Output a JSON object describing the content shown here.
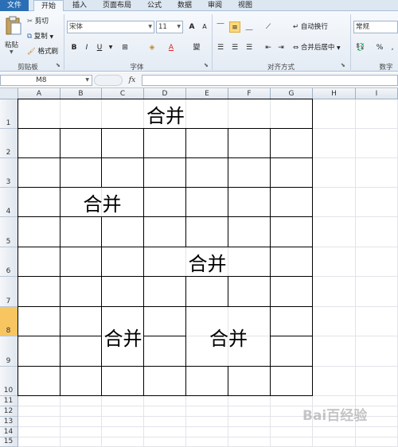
{
  "tabs": [
    "文件",
    "开始",
    "插入",
    "页面布局",
    "公式",
    "数据",
    "审阅",
    "视图"
  ],
  "active_tab": "开始",
  "ribbon": {
    "clipboard": {
      "paste": "粘贴",
      "cut": "剪切",
      "copy": "复制",
      "format_painter": "格式刷",
      "group": "剪贴板"
    },
    "font": {
      "name": "宋体",
      "size": "11",
      "bold": "B",
      "italic": "I",
      "underline": "U",
      "wen": "變",
      "font_color_glyph": "A",
      "grow": "A",
      "shrink": "A",
      "group": "字体"
    },
    "alignment": {
      "wrap": "自动换行",
      "merge": "合并后居中",
      "group": "对齐方式"
    },
    "number": {
      "format": "常规",
      "percent": "%",
      "comma": ",",
      "group": "数字"
    }
  },
  "formula_bar": {
    "cell_ref": "M8",
    "fx": "fx",
    "content": ""
  },
  "columns": [
    "A",
    "B",
    "C",
    "D",
    "E",
    "F",
    "G",
    "H",
    "I"
  ],
  "rows": [
    "1",
    "2",
    "3",
    "4",
    "5",
    "6",
    "7",
    "8",
    "9",
    "10",
    "11",
    "12",
    "13",
    "14",
    "15"
  ],
  "selected_row": "8",
  "merged_cells": [
    {
      "range": "A1:G1",
      "text": "合并"
    },
    {
      "range": "B4:C4",
      "text": "合并"
    },
    {
      "range": "D6:F6",
      "text": "合并"
    },
    {
      "range": "C8:C9",
      "text": "合并"
    },
    {
      "range": "E8:F9",
      "text": "合并"
    }
  ],
  "watermark": "Bai百经验",
  "colors": {
    "file_tab": "#2a6fb5",
    "selected_row_header": "#f7c660",
    "ribbon_bg": "#e3ebf4"
  }
}
